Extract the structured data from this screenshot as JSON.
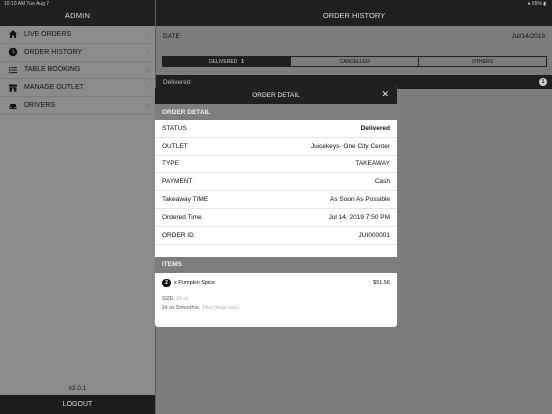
{
  "status_bar": {
    "left": "10:10 AM  Tue Aug 7",
    "right": "● 55% ▮"
  },
  "sidebar": {
    "title": "ADMIN",
    "items": [
      {
        "label": "LIVE ORDERS",
        "icon": "home-icon"
      },
      {
        "label": "ORDER HISTORY",
        "icon": "clock-icon"
      },
      {
        "label": "TABLE BOOKING",
        "icon": "list-icon"
      },
      {
        "label": "MANAGE OUTLET",
        "icon": "store-icon"
      },
      {
        "label": "DRIVERS",
        "icon": "car-icon"
      }
    ],
    "version": "v2.0.1",
    "logout_label": "LOGOUT"
  },
  "main": {
    "title": "ORDER HISTORY",
    "date_label": "DATE",
    "date_value": "Jul/14/2019",
    "segments": [
      {
        "label": "DELIVERED",
        "count": "1",
        "active": true
      },
      {
        "label": "CANCELLED",
        "count": "",
        "active": false
      },
      {
        "label": "OTHERS",
        "count": "",
        "active": false
      }
    ],
    "list_header": "Delivered",
    "list_count": "1"
  },
  "modal": {
    "title": "ORDER DETAIL",
    "close_glyph": "✕",
    "detail_section": "ORDER DETAIL",
    "details": [
      {
        "label": "STATUS",
        "value": "Delivered"
      },
      {
        "label": "OUTLET",
        "value": "Juicekeys- One City Center"
      },
      {
        "label": "TYPE",
        "value": "TAKEAWAY"
      },
      {
        "label": "PAYMENT",
        "value": "Cash"
      },
      {
        "label": "Takeaway TIME",
        "value": "As Soon As Possible"
      },
      {
        "label": "Ordered Time",
        "value": "Jul 14, 2019 7:50 PM"
      },
      {
        "label": "ORDER ID",
        "value": "JUI000001"
      }
    ],
    "items_section": "ITEMS",
    "items": [
      {
        "qty": "2",
        "name": "x Pumpkin Spice",
        "price": "$51.56",
        "size_label": "SIZE:",
        "size_value": "24 oz.",
        "option_label": "24 oz Smoothie:",
        "option_value": "24oz (large size)."
      }
    ]
  }
}
